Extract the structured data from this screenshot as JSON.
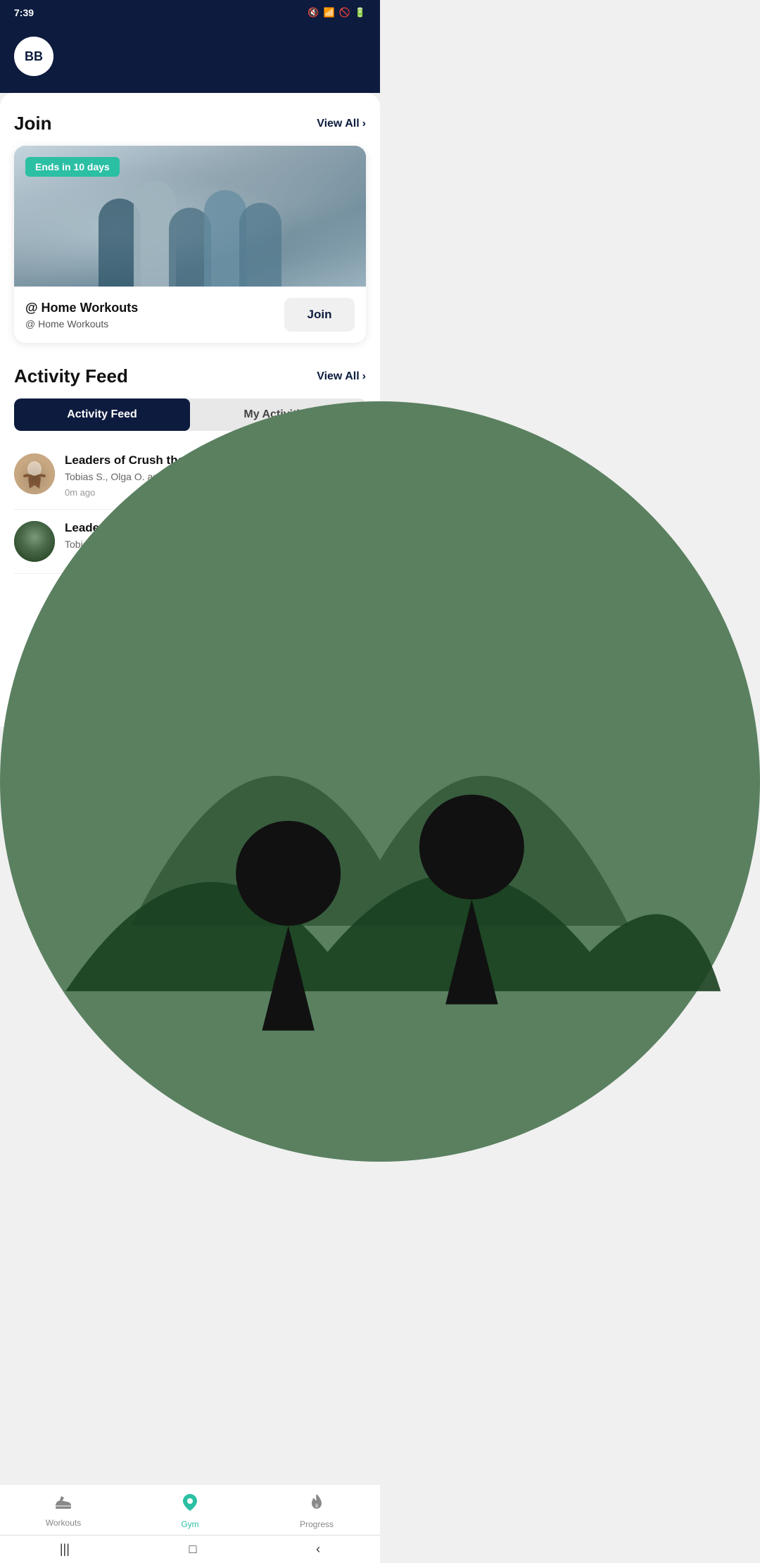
{
  "statusBar": {
    "time": "7:39",
    "icons": [
      "clipboard-icon",
      "android-icon",
      "bag-icon",
      "more-icon",
      "mute-icon",
      "wifi-icon",
      "block-icon",
      "battery-icon"
    ]
  },
  "header": {
    "avatar": "BB"
  },
  "joinSection": {
    "title": "Join",
    "viewAllLabel": "View All",
    "badge": "Ends in 10 days",
    "cardTitle": "@ Home Workouts",
    "cardSubtitle": "@ Home Workouts",
    "joinButtonLabel": "Join"
  },
  "activityFeed": {
    "title": "Activity Feed",
    "viewAllLabel": "View All",
    "tabs": [
      {
        "label": "Activity Feed",
        "active": true
      },
      {
        "label": "My Activities",
        "active": false
      }
    ],
    "items": [
      {
        "title": "Leaders of Crush the Calories!",
        "description": "Tobias S., Olga O. and David B. are leading in Crush the Calories!",
        "time": "0m ago",
        "avatarType": "yoga"
      },
      {
        "title": "Leaders of Crush the Calories!",
        "description": "Tobias S., Olga O. and David B. are",
        "time": "",
        "avatarType": "outdoor"
      }
    ]
  },
  "bottomNav": {
    "items": [
      {
        "label": "Workouts",
        "active": false,
        "iconType": "shoe"
      },
      {
        "label": "Gym",
        "active": true,
        "iconType": "location"
      },
      {
        "label": "Progress",
        "active": false,
        "iconType": "flame"
      }
    ]
  },
  "androidNav": {
    "buttons": [
      "|||",
      "□",
      "<"
    ]
  }
}
